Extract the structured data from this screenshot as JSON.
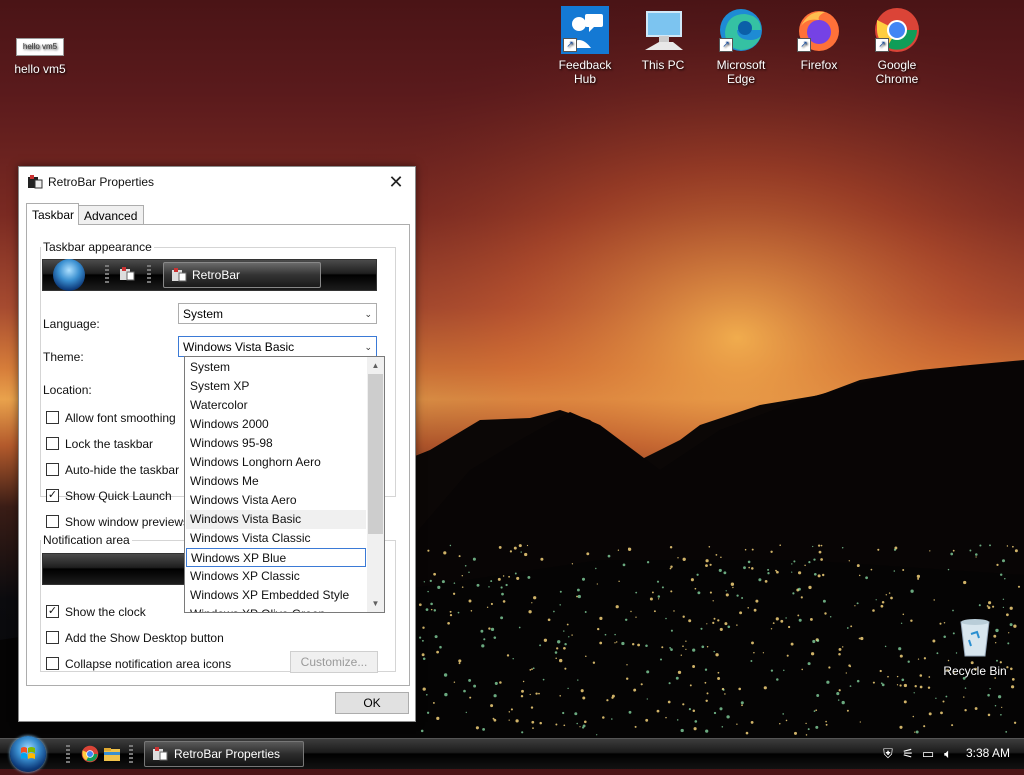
{
  "desktop": {
    "icons": [
      {
        "label": "hello vm5",
        "name": "hello-vm5-icon",
        "thumb_text": "hello vm5"
      },
      {
        "label": "Feedback Hub",
        "name": "feedback-hub-icon"
      },
      {
        "label": "This PC",
        "name": "this-pc-icon"
      },
      {
        "label": "Microsoft Edge",
        "name": "edge-icon"
      },
      {
        "label": "Firefox",
        "name": "firefox-icon"
      },
      {
        "label": "Google Chrome",
        "name": "chrome-icon"
      },
      {
        "label": "Recycle Bin",
        "name": "recycle-bin-icon"
      }
    ]
  },
  "dialog": {
    "title": "RetroBar Properties",
    "tabs": [
      {
        "label": "Taskbar",
        "active": true
      },
      {
        "label": "Advanced",
        "active": false
      }
    ],
    "appearance_group": {
      "title": "Taskbar appearance",
      "preview_button": "RetroBar"
    },
    "language": {
      "label": "Language:",
      "value": "System"
    },
    "theme": {
      "label": "Theme:",
      "value": "Windows Vista Basic"
    },
    "location": {
      "label": "Location:"
    },
    "checkboxes": [
      {
        "label": "Allow font smoothing",
        "checked": false
      },
      {
        "label": "Lock the taskbar",
        "checked": false
      },
      {
        "label": "Auto-hide the taskbar",
        "checked": false
      },
      {
        "label": "Show Quick Launch",
        "checked": true
      },
      {
        "label": "Show window previews",
        "checked": false
      }
    ],
    "notification_group": {
      "title": "Notification area",
      "checkboxes": [
        {
          "label": "Show the clock",
          "checked": true
        },
        {
          "label": "Add the Show Desktop button",
          "checked": false
        },
        {
          "label": "Collapse notification area icons",
          "checked": false
        }
      ],
      "customize_button": "Customize..."
    },
    "ok_button": "OK",
    "theme_dropdown": {
      "items": [
        "System",
        "System XP",
        "Watercolor",
        "Windows 2000",
        "Windows 95-98",
        "Windows Longhorn Aero",
        "Windows Me",
        "Windows Vista Aero",
        "Windows Vista Basic",
        "Windows Vista Classic",
        "Windows XP Blue",
        "Windows XP Classic",
        "Windows XP Embedded Style",
        "Windows XP Olive Green"
      ],
      "selected": "Windows Vista Basic",
      "focused": "Windows XP Blue"
    }
  },
  "taskbar": {
    "window_button": "RetroBar Properties",
    "clock": "3:38 AM"
  },
  "colors": {
    "focus_border": "#3b7ad6",
    "dialog_bg": "#ffffff"
  }
}
